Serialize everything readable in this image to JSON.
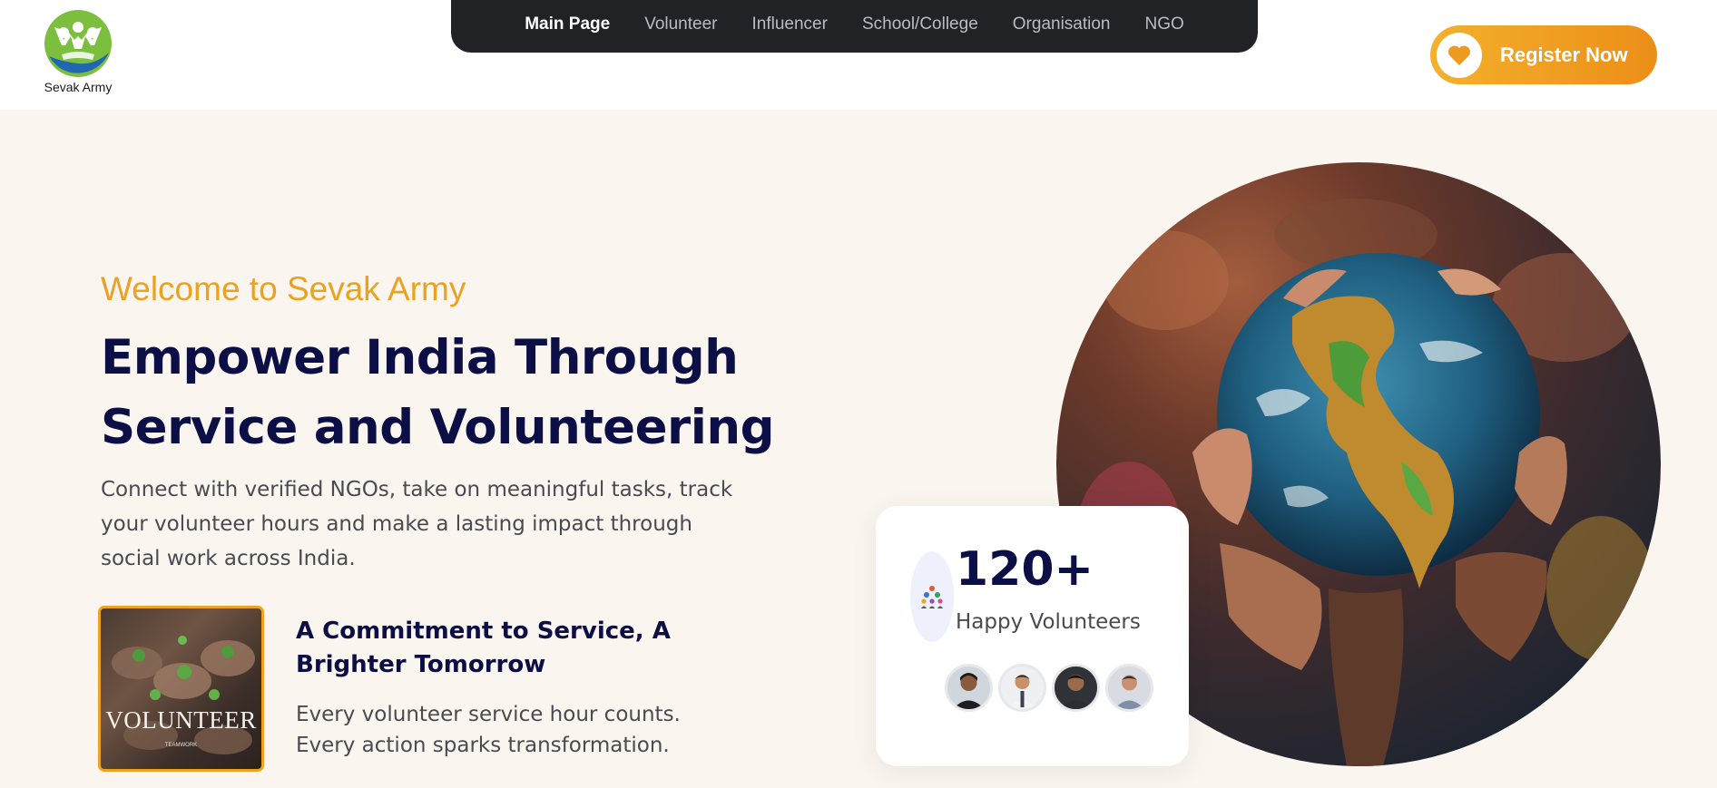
{
  "brand": {
    "name": "Sevak Army",
    "logo_icon": "people-hands-logo-icon"
  },
  "nav": {
    "items": [
      {
        "label": "Main Page",
        "active": true
      },
      {
        "label": "Volunteer",
        "active": false
      },
      {
        "label": "Influencer",
        "active": false
      },
      {
        "label": "School/College",
        "active": false
      },
      {
        "label": "Organisation",
        "active": false
      },
      {
        "label": "NGO",
        "active": false
      }
    ]
  },
  "register": {
    "label": "Register Now",
    "icon": "heart-icon"
  },
  "hero": {
    "welcome": "Welcome to Sevak Army",
    "headline_line1": "Empower India Through",
    "headline_line2": "Service and Volunteering",
    "description": "Connect with verified NGOs, take on meaningful tasks, track your volunteer hours and make a lasting impact through social work across India.",
    "image": "hands-holding-globe-photo"
  },
  "commitment": {
    "thumbnail_title": "VOLUNTEER",
    "thumbnail_subtitle": "TEAMWORK",
    "title": "A Commitment to Service, A Brighter Tomorrow",
    "body_line1": "Every volunteer service hour counts.",
    "body_line2": "Every action sparks transformation."
  },
  "stats": {
    "number": "120+",
    "label": "Happy Volunteers",
    "icon": "group-of-people-icon",
    "avatars": [
      "volunteer-avatar-1",
      "volunteer-avatar-2",
      "volunteer-avatar-3",
      "volunteer-avatar-4"
    ]
  },
  "colors": {
    "accent_orange": "#eba122",
    "navy": "#0c0f45",
    "nav_bg": "#212226",
    "hero_bg": "#faf6ef"
  }
}
